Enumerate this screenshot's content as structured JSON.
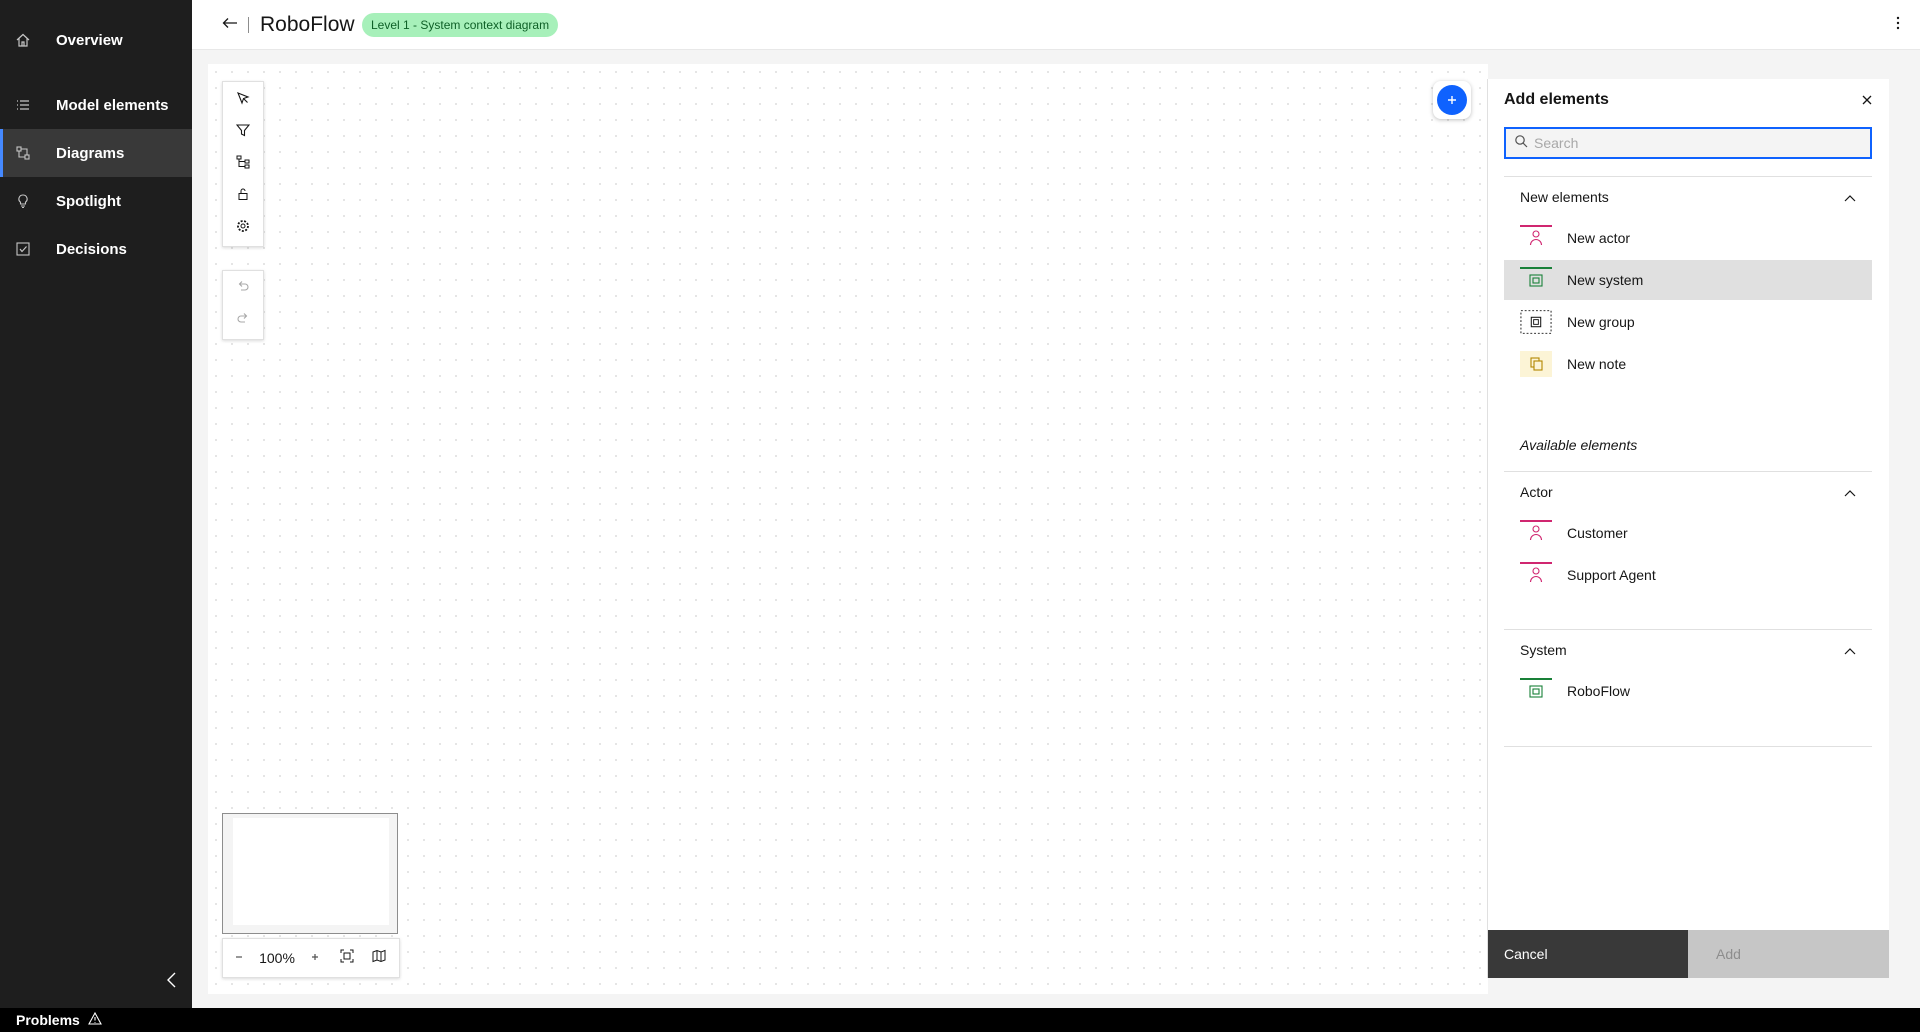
{
  "sidebar": {
    "items": [
      {
        "label": "Overview",
        "icon": "home-icon"
      },
      {
        "label": "Model elements",
        "icon": "list-icon"
      },
      {
        "label": "Diagrams",
        "icon": "diagram-icon",
        "active": true
      },
      {
        "label": "Spotlight",
        "icon": "lightbulb-icon"
      },
      {
        "label": "Decisions",
        "icon": "checkbox-icon"
      }
    ]
  },
  "header": {
    "title": "RoboFlow",
    "badge": "Level 1 - System context diagram"
  },
  "zoom": {
    "value": "100%"
  },
  "panel": {
    "title": "Add elements",
    "search_placeholder": "Search",
    "new_section": {
      "title": "New elements",
      "items": [
        "New actor",
        "New system",
        "New group",
        "New note"
      ]
    },
    "available_title": "Available elements",
    "actor_section": {
      "title": "Actor",
      "items": [
        "Customer",
        "Support Agent"
      ]
    },
    "system_section": {
      "title": "System",
      "items": [
        "RoboFlow"
      ]
    },
    "cancel_label": "Cancel",
    "add_label": "Add"
  },
  "statusbar": {
    "problems_label": "Problems"
  },
  "colors": {
    "sidebar_bg": "#1e1e1e",
    "accent": "#0f62fe",
    "badge_bg": "#a7f0ba",
    "actor_color": "#d02670",
    "system_color": "#198038",
    "note_color": "#f1c21b"
  }
}
